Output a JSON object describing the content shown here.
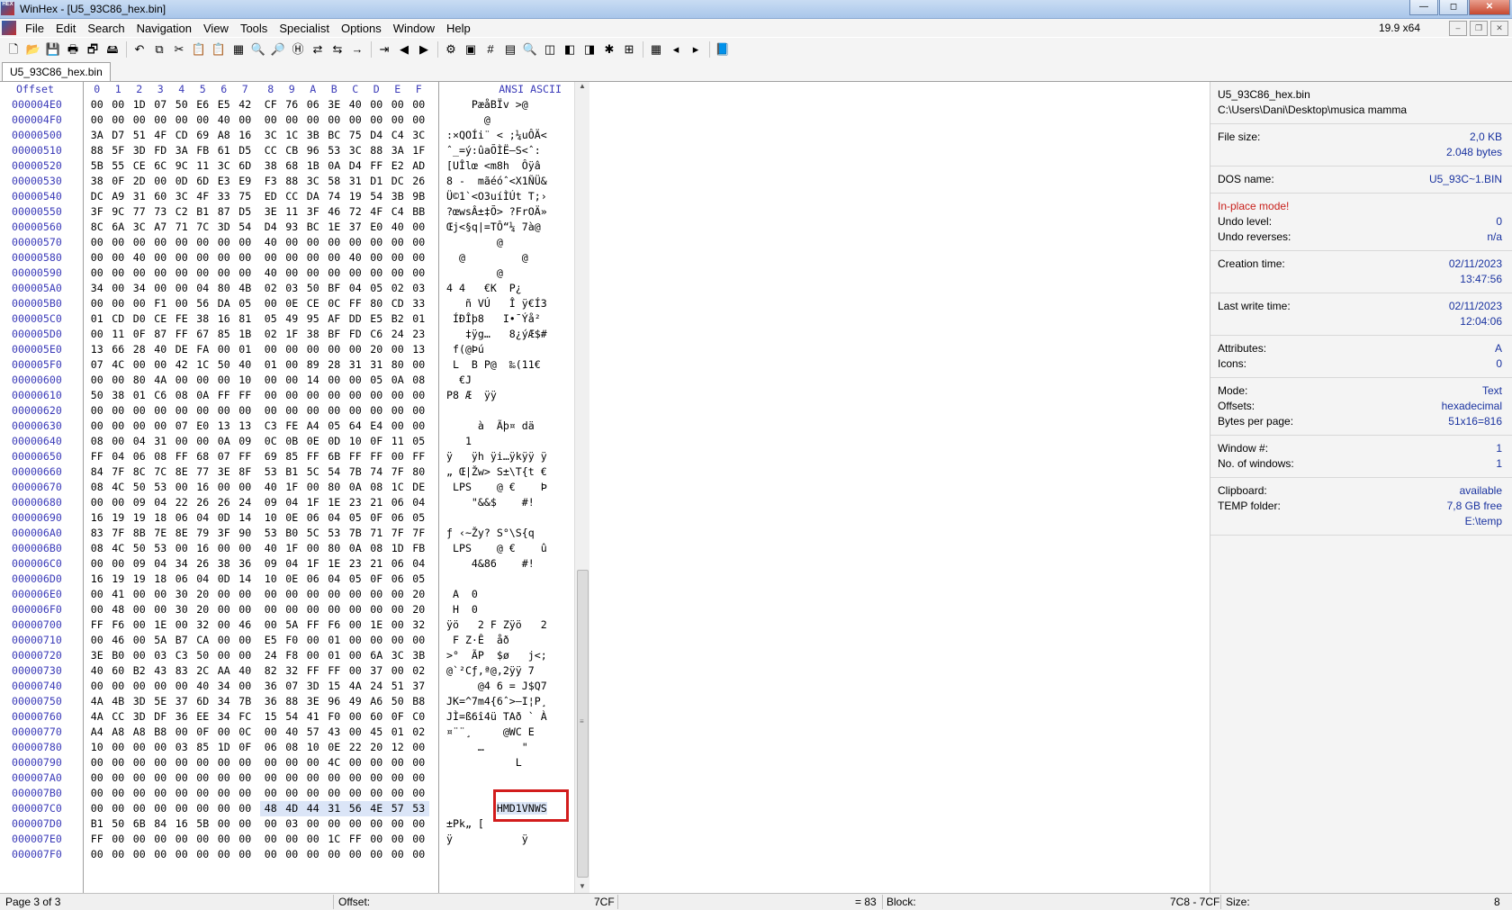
{
  "window": {
    "title": "WinHex - [U5_93C86_hex.bin]",
    "app_icon_text": "HEX",
    "version": "19.9 x64"
  },
  "menu": [
    "File",
    "Edit",
    "Search",
    "Navigation",
    "View",
    "Tools",
    "Specialist",
    "Options",
    "Window",
    "Help"
  ],
  "tab": "U5_93C86_hex.bin",
  "hex_header": {
    "offset": "Offset",
    "columns": [
      "0",
      "1",
      "2",
      "3",
      "4",
      "5",
      "6",
      "7",
      "8",
      "9",
      "A",
      "B",
      "C",
      "D",
      "E",
      "F"
    ],
    "ansi": "ANSI ASCII"
  },
  "rows": [
    {
      "offset": "000004E0",
      "hex": "00 00 1D 07 50 E6 E5 42 CF 76 06 3E 40 00 00 00",
      "ansi": "    PæåBÏv >@   "
    },
    {
      "offset": "000004F0",
      "hex": "00 00 00 00 00 00 40 00 00 00 00 00 00 00 00 00",
      "ansi": "      @         "
    },
    {
      "offset": "00000500",
      "hex": "3A D7 51 4F CD 69 A8 16 3C 1C 3B BC 75 D4 C4 3C",
      "ansi": ":×QOÍi¨ < ;¼uÔÄ<"
    },
    {
      "offset": "00000510",
      "hex": "88 5F 3D FD 3A FB 61 D5 CC CB 96 53 3C 88 3A 1F",
      "ansi": "ˆ_=ý:ûaÕÌË–S<ˆ: "
    },
    {
      "offset": "00000520",
      "hex": "5B 55 CE 6C 9C 11 3C 6D 38 68 1B 0A D4 FF E2 AD",
      "ansi": "[UÎlœ <m8h  Ôÿâ­"
    },
    {
      "offset": "00000530",
      "hex": "38 0F 2D 00 0D 6D E3 E9 F3 88 3C 58 31 D1 DC 26",
      "ansi": "8 -  mãéóˆ<X1ÑÜ&"
    },
    {
      "offset": "00000540",
      "hex": "DC A9 31 60 3C 4F 33 75 ED CC DA 74 19 54 3B 9B",
      "ansi": "Ü©1`<O3uíÌÚt T;›"
    },
    {
      "offset": "00000550",
      "hex": "3F 9C 77 73 C2 B1 87 D5 3E 11 3F 46 72 4F C4 BB",
      "ansi": "?œwsÂ±‡Õ> ?FrOÄ»"
    },
    {
      "offset": "00000560",
      "hex": "8C 6A 3C A7 71 7C 3D 54 D4 93 BC 1E 37 E0 40 00",
      "ansi": "Œj<§q|=TÔ“¼ 7à@ "
    },
    {
      "offset": "00000570",
      "hex": "00 00 00 00 00 00 00 00 40 00 00 00 00 00 00 00",
      "ansi": "        @       "
    },
    {
      "offset": "00000580",
      "hex": "00 00 40 00 00 00 00 00 00 00 00 00 40 00 00 00",
      "ansi": "  @         @   "
    },
    {
      "offset": "00000590",
      "hex": "00 00 00 00 00 00 00 00 40 00 00 00 00 00 00 00",
      "ansi": "        @       "
    },
    {
      "offset": "000005A0",
      "hex": "34 00 34 00 00 04 80 4B 02 03 50 BF 04 05 02 03",
      "ansi": "4 4   €K  P¿    "
    },
    {
      "offset": "000005B0",
      "hex": "00 00 00 F1 00 56 DA 05 00 0E CE 0C FF 80 CD 33",
      "ansi": "   ñ VÚ   Î ÿ€Í3"
    },
    {
      "offset": "000005C0",
      "hex": "01 CD D0 CE FE 38 16 81 05 49 95 AF DD E5 B2 01",
      "ansi": " ÍÐÎþ8   I•¯Ýå² "
    },
    {
      "offset": "000005D0",
      "hex": "00 11 0F 87 FF 67 85 1B 02 1F 38 BF FD C6 24 23",
      "ansi": "   ‡ÿg…   8¿ýÆ$#"
    },
    {
      "offset": "000005E0",
      "hex": "13 66 28 40 DE FA 00 01 00 00 00 00 00 20 00 13",
      "ansi": " f(@Þú          "
    },
    {
      "offset": "000005F0",
      "hex": "07 4C 00 00 42 1C 50 40 01 00 89 28 31 31 80 00",
      "ansi": " L  B P@  ‰(11€ "
    },
    {
      "offset": "00000600",
      "hex": "00 00 80 4A 00 00 00 10 00 00 14 00 00 05 0A 08",
      "ansi": "  €J            "
    },
    {
      "offset": "00000610",
      "hex": "50 38 01 C6 08 0A FF FF 00 00 00 00 00 00 00 00",
      "ansi": "P8 Æ  ÿÿ        "
    },
    {
      "offset": "00000620",
      "hex": "00 00 00 00 00 00 00 00 00 00 00 00 00 00 00 00",
      "ansi": "                "
    },
    {
      "offset": "00000630",
      "hex": "00 00 00 00 07 E0 13 13 C3 FE A4 05 64 E4 00 00",
      "ansi": "     à  Ãþ¤ dä  "
    },
    {
      "offset": "00000640",
      "hex": "08 00 04 31 00 00 0A 09 0C 0B 0E 0D 10 0F 11 05",
      "ansi": "   1            "
    },
    {
      "offset": "00000650",
      "hex": "FF 04 06 08 FF 68 07 FF 69 85 FF 6B FF FF 00 FF",
      "ansi": "ÿ   ÿh ÿi…ÿkÿÿ ÿ"
    },
    {
      "offset": "00000660",
      "hex": "84 7F 8C 7C 8E 77 3E 8F 53 B1 5C 54 7B 74 7F 80",
      "ansi": "„ Œ|Žw> S±\\T{t €"
    },
    {
      "offset": "00000670",
      "hex": "08 4C 50 53 00 16 00 00 40 1F 00 80 0A 08 1C DE",
      "ansi": " LPS    @ €    Þ"
    },
    {
      "offset": "00000680",
      "hex": "00 00 09 04 22 26 26 24 09 04 1F 1E 23 21 06 04",
      "ansi": "    \"&&$    #!  "
    },
    {
      "offset": "00000690",
      "hex": "16 19 19 18 06 04 0D 14 10 0E 06 04 05 0F 06 05",
      "ansi": "                "
    },
    {
      "offset": "000006A0",
      "hex": "83 7F 8B 7E 8E 79 3F 90 53 B0 5C 53 7B 71 7F 7F",
      "ansi": "ƒ ‹~Žy? S°\\S{q  "
    },
    {
      "offset": "000006B0",
      "hex": "08 4C 50 53 00 16 00 00 40 1F 00 80 0A 08 1D FB",
      "ansi": " LPS    @ €    û"
    },
    {
      "offset": "000006C0",
      "hex": "00 00 09 04 34 26 38 36 09 04 1F 1E 23 21 06 04",
      "ansi": "    4&86    #!  "
    },
    {
      "offset": "000006D0",
      "hex": "16 19 19 18 06 04 0D 14 10 0E 06 04 05 0F 06 05",
      "ansi": "                "
    },
    {
      "offset": "000006E0",
      "hex": "00 41 00 00 30 20 00 00 00 00 00 00 00 00 00 20",
      "ansi": " A  0           "
    },
    {
      "offset": "000006F0",
      "hex": "00 48 00 00 30 20 00 00 00 00 00 00 00 00 00 20",
      "ansi": " H  0           "
    },
    {
      "offset": "00000700",
      "hex": "FF F6 00 1E 00 32 00 46 00 5A FF F6 00 1E 00 32",
      "ansi": "ÿö   2 F Zÿö   2"
    },
    {
      "offset": "00000710",
      "hex": "00 46 00 5A B7 CA 00 00 E5 F0 00 01 00 00 00 00",
      "ansi": " F Z·Ê  åð      "
    },
    {
      "offset": "00000720",
      "hex": "3E B0 00 03 C3 50 00 00 24 F8 00 01 00 6A 3C 3B",
      "ansi": ">°  ÃP  $ø   j<;"
    },
    {
      "offset": "00000730",
      "hex": "40 60 B2 43 83 2C AA 40 82 32 FF FF 00 37 00 02",
      "ansi": "@`²Cƒ,ª@‚2ÿÿ 7  "
    },
    {
      "offset": "00000740",
      "hex": "00 00 00 00 00 40 34 00 36 07 3D 15 4A 24 51 37",
      "ansi": "     @4 6 = J$Q7"
    },
    {
      "offset": "00000750",
      "hex": "4A 4B 3D 5E 37 6D 34 7B 36 88 3E 96 49 A6 50 B8",
      "ansi": "JK=^7m4{6ˆ>–I¦P¸"
    },
    {
      "offset": "00000760",
      "hex": "4A CC 3D DF 36 EE 34 FC 15 54 41 F0 00 60 0F C0",
      "ansi": "JÌ=ß6î4ü TAð ` À"
    },
    {
      "offset": "00000770",
      "hex": "A4 A8 A8 B8 00 0F 00 0C 00 40 57 43 00 45 01 02",
      "ansi": "¤¨¨¸     @WC E  "
    },
    {
      "offset": "00000780",
      "hex": "10 00 00 00 03 85 1D 0F 06 08 10 0E 22 20 12 00",
      "ansi": "     …      \"   "
    },
    {
      "offset": "00000790",
      "hex": "00 00 00 00 00 00 00 00 00 00 00 4C 00 00 00 00",
      "ansi": "           L    "
    },
    {
      "offset": "000007A0",
      "hex": "00 00 00 00 00 00 00 00 00 00 00 00 00 00 00 00",
      "ansi": "                "
    },
    {
      "offset": "000007B0",
      "hex": "00 00 00 00 00 00 00 00 00 00 00 00 00 00 00 00",
      "ansi": "                "
    },
    {
      "offset": "000007C0",
      "hex": "00 00 00 00 00 00 00 00 48 4D 44 31 56 4E 57 53",
      "ansi": "        HMD1VNWS"
    },
    {
      "offset": "000007D0",
      "hex": "B1 50 6B 84 16 5B 00 00 00 03 00 00 00 00 00 00",
      "ansi": "±Pk„ [          "
    },
    {
      "offset": "000007E0",
      "hex": "FF 00 00 00 00 00 00 00 00 00 00 1C FF 00 00 00",
      "ansi": "ÿ           ÿ   "
    },
    {
      "offset": "000007F0",
      "hex": "00 00 00 00 00 00 00 00 00 00 00 00 00 00 00 00",
      "ansi": "                "
    }
  ],
  "info": {
    "filename": "U5_93C86_hex.bin",
    "path": "C:\\Users\\Dani\\Desktop\\musica mamma",
    "file_size_label": "File size:",
    "file_size_kb": "2,0 KB",
    "file_size_bytes": "2.048 bytes",
    "dos_name_label": "DOS name:",
    "dos_name": "U5_93C~1.BIN",
    "inplace": "In-place mode!",
    "undo_level_label": "Undo level:",
    "undo_level": "0",
    "undo_reverses_label": "Undo reverses:",
    "undo_reverses": "n/a",
    "creation_label": "Creation time:",
    "creation_date": "02/11/2023",
    "creation_time": "13:47:56",
    "lastwrite_label": "Last write time:",
    "lastwrite_date": "02/11/2023",
    "lastwrite_time": "12:04:06",
    "attributes_label": "Attributes:",
    "attributes": "A",
    "icons_label": "Icons:",
    "icons": "0",
    "mode_label": "Mode:",
    "mode": "Text",
    "offsets_label": "Offsets:",
    "offsets": "hexadecimal",
    "bpp_label": "Bytes per page:",
    "bpp": "51x16=816",
    "window_no_label": "Window #:",
    "window_no": "1",
    "no_windows_label": "No. of windows:",
    "no_windows": "1",
    "clipboard_label": "Clipboard:",
    "clipboard": "available",
    "temp_label": "TEMP folder:",
    "temp_free": "7,8 GB free",
    "temp_path": "E:\\temp"
  },
  "status": {
    "page": "Page 3 of 3",
    "offset_label": "Offset:",
    "offset_value": "7CF",
    "value": "= 83",
    "block_label": "Block:",
    "block_value": "7C8 - 7CF",
    "size_label": "Size:",
    "size_value": "8"
  },
  "colors": {
    "offset_blue": "#3a3ab8",
    "selection": "#dbe5f7",
    "highlight_box": "#d21c1c",
    "info_value_blue": "#1a33a0"
  },
  "toolbar_icons": [
    "new-file",
    "open-file",
    "save",
    "print",
    "properties",
    "open-disk",
    "undo",
    "copy",
    "cut",
    "paste",
    "paste-special",
    "write-zeros",
    "find",
    "find-text",
    "find-hex",
    "replace-text",
    "replace-hex",
    "goto-offset",
    "goto-sector",
    "back",
    "forward",
    "disk-tools",
    "ram-editor",
    "hash",
    "calculator",
    "search",
    "view-1",
    "view-2",
    "view-3",
    "data-interpreter",
    "options-grid",
    "options-table",
    "prev-page",
    "next-page",
    "help-book"
  ],
  "highlight": {
    "row": "000007C0",
    "text": "HMD1VNWS"
  }
}
